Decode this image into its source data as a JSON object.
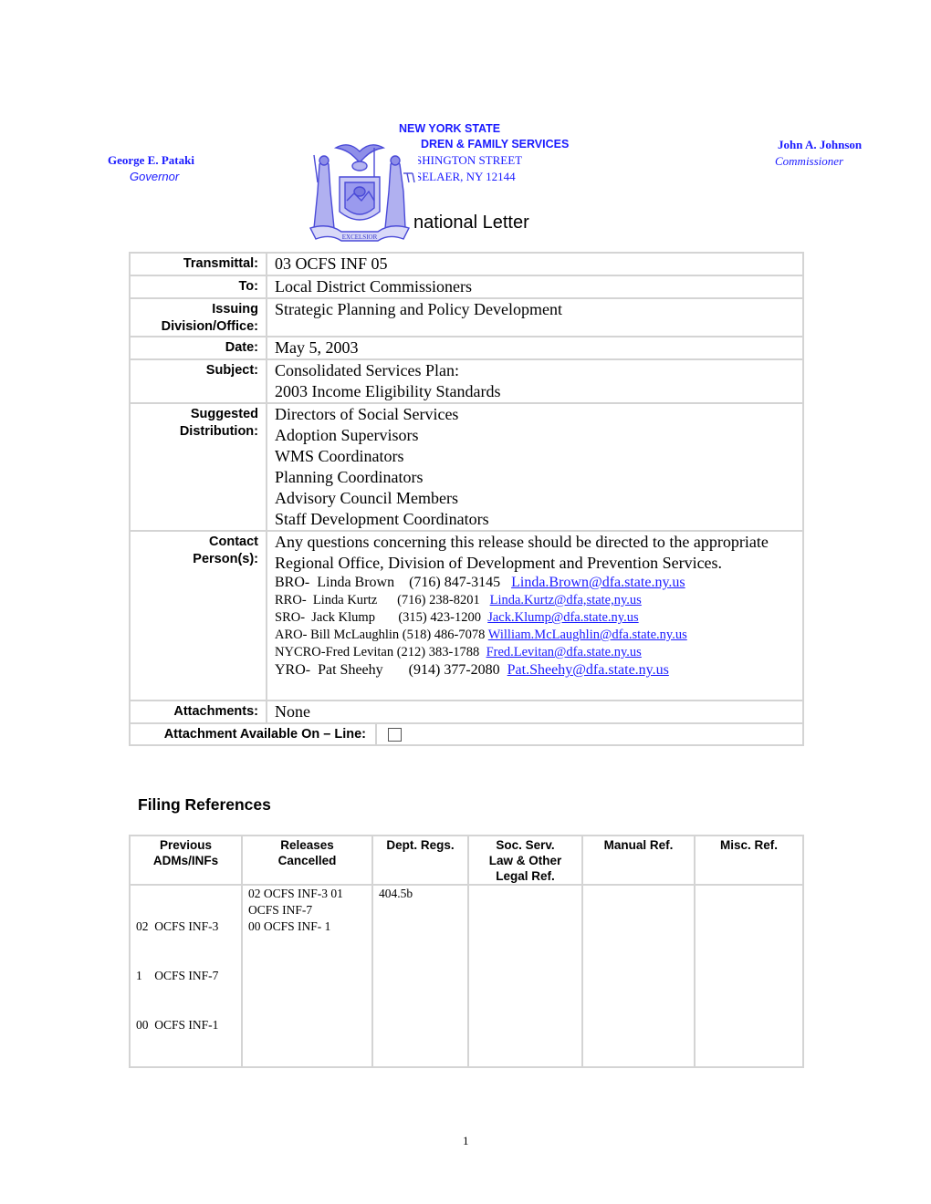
{
  "letterhead": {
    "state": "NEW YORK STATE",
    "agency": "DREN & FAMILY SERVICES",
    "street": "SHINGTON STREET",
    "city": "SELAER, NY 12144",
    "governor_name": "George E. Pataki",
    "governor_title": "Governor",
    "commissioner_name": "John A. Johnson",
    "commissioner_title": "Commissioner",
    "seal_icon": "new-york-state-seal",
    "seal_motto": "EXCELSIOR"
  },
  "document_title": "national Letter",
  "info_table": {
    "transmittal_label": "Transmittal:",
    "transmittal_value": "03 OCFS INF 05",
    "to_label": "To:",
    "to_value": "Local District Commissioners",
    "issuing_label_1": "Issuing",
    "issuing_label_2": "Division/Office:",
    "issuing_value": "Strategic Planning and Policy Development",
    "date_label": "Date:",
    "date_value": "May 5, 2003",
    "subject_label": "Subject:",
    "subject_lines": [
      "Consolidated Services Plan:",
      "2003 Income Eligibility Standards"
    ],
    "distribution_label_1": "Suggested",
    "distribution_label_2": "Distribution:",
    "distribution": [
      "Directors of Social Services",
      "Adoption Supervisors",
      "WMS Coordinators",
      "Planning Coordinators",
      "Advisory Council Members",
      "Staff Development Coordinators"
    ],
    "contact_label_1": "Contact",
    "contact_label_2": "Person(s):",
    "contact_intro": "Any questions concerning this release should be directed to the appropriate Regional Office, Division of Development and Prevention Services.",
    "contacts": [
      {
        "text": "BRO-  Linda Brown    (716) 847-3145",
        "email": "Linda.Brown@dfa.state.ny.us"
      },
      {
        "text": "RRO-  Linda Kurtz      (716) 238-8201",
        "email": "Linda.Kurtz@dfa,state,ny.us"
      },
      {
        "text": "SRO-  Jack Klump       (315) 423-1200",
        "email": "Jack.Klump@dfa.state.ny.us"
      },
      {
        "text": "ARO- Bill McLaughlin (518) 486-7078",
        "email": "William.McLaughlin@dfa.state.ny.us"
      },
      {
        "text": "NYCRO-Fred Levitan (212) 383-1788",
        "email": "Fred.Levitan@dfa.state.ny.us"
      },
      {
        "text": "YRO-  Pat Sheehy       (914) 377-2080",
        "email": "Pat.Sheehy@dfa.state.ny.us"
      }
    ],
    "attachments_label": "Attachments:",
    "attachments_value": "None",
    "online_label": "Attachment Available On – Line:",
    "online_checked": false
  },
  "filing": {
    "heading": "Filing References",
    "headers": [
      [
        "Previous",
        "ADMs/INFs"
      ],
      [
        "Releases",
        "Cancelled"
      ],
      [
        "Dept. Regs."
      ],
      [
        "Soc. Serv.",
        "Law & Other",
        "Legal Ref."
      ],
      [
        "Manual Ref."
      ],
      [
        "Misc. Ref."
      ]
    ],
    "row": [
      [
        "02  OCFS INF-3",
        "1    OCFS INF-7",
        "00  OCFS INF-1"
      ],
      [
        "02 OCFS INF-3 01",
        "OCFS INF-7",
        "00 OCFS INF- 1"
      ],
      [
        "404.5b"
      ],
      [],
      [],
      []
    ]
  },
  "page_number": "1"
}
